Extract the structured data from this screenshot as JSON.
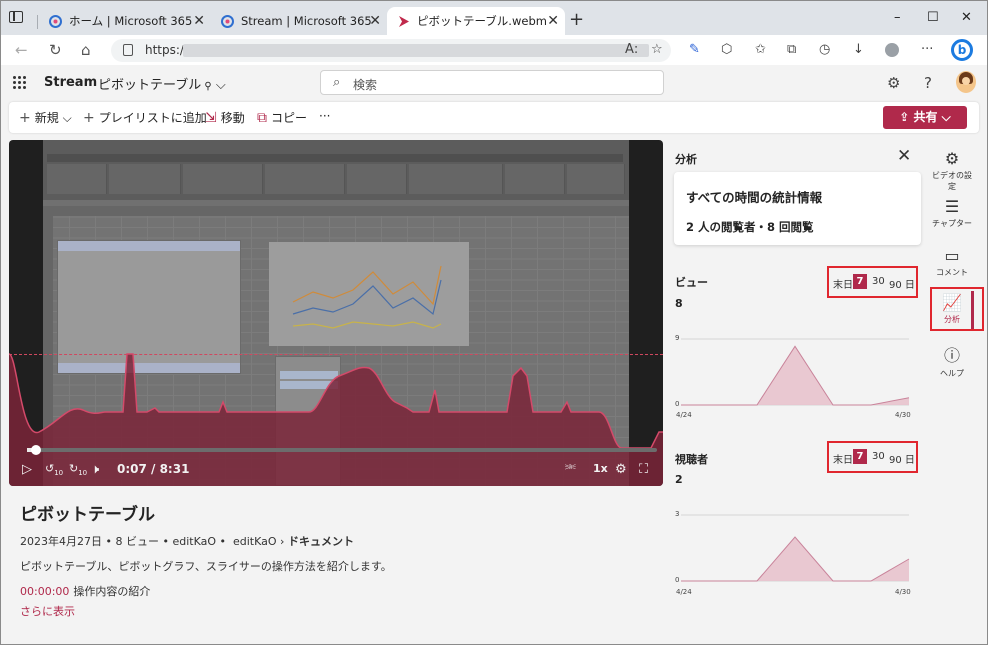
{
  "browser": {
    "tabs": [
      {
        "label": "ホーム | Microsoft 365",
        "active": false
      },
      {
        "label": "Stream | Microsoft 365",
        "active": false
      },
      {
        "label": "ピボットテーブル.webm",
        "active": true
      }
    ],
    "url_prefix": "https://",
    "new_tab": "+",
    "window_controls": [
      "–",
      "☐",
      "✕"
    ]
  },
  "app": {
    "name": "Stream",
    "document_title": "ピボットテーブル",
    "search_placeholder": "検索"
  },
  "commands": {
    "new": "新規",
    "add_to_playlist": "プレイリストに追加",
    "move": "移動",
    "copy": "コピー",
    "more": "···",
    "share": "共有"
  },
  "player": {
    "time": "0:07 / 8:31",
    "speed": "1x",
    "progress": 0.014,
    "skip_back": "10",
    "skip_fwd": "10"
  },
  "video_info": {
    "title": "ピボットテーブル",
    "date": "2023年4月27日",
    "views": "8 ビュー",
    "owner": "editKaO",
    "path_owner": "editKaO",
    "path_folder": "ドキュメント",
    "description": "ピボットテーブル、ピボットグラフ、スライサーの操作方法を紹介します。",
    "chapter_time": "00:00:00",
    "chapter_label": "操作内容の紹介",
    "show_more": "さらに表示"
  },
  "analytics": {
    "title": "分析",
    "stat_heading": "すべての時間の統計情報",
    "stat_summary": "2 人の閲覧者・8 回閲覧",
    "views": {
      "label": "ビュー",
      "total": "8",
      "range_options": [
        "末日",
        "7",
        "30",
        "90 日"
      ],
      "selected": "7",
      "y_max_label": "9",
      "y_min_label": "0",
      "x_start": "4/24",
      "x_end": "4/30",
      "series": [
        0,
        0,
        0,
        8,
        0,
        0,
        1
      ]
    },
    "viewers": {
      "label": "視聴者",
      "total": "2",
      "range_options": [
        "末日",
        "7",
        "30",
        "90 日"
      ],
      "selected": "7",
      "y_max_label": "3",
      "y_min_label": "0",
      "x_start": "4/24",
      "x_end": "4/30",
      "series": [
        0,
        0,
        0,
        2,
        0,
        0,
        1
      ]
    }
  },
  "rail": {
    "video_settings": "ビデオの設定",
    "chapters": "チャプター",
    "comments": "コメント",
    "analytics": "分析",
    "help": "ヘルプ"
  },
  "colors": {
    "accent": "#b0294b",
    "highlight_box": "#e0262e",
    "chart_fill": "#e8c3cd",
    "chart_stroke": "#b0294b"
  }
}
